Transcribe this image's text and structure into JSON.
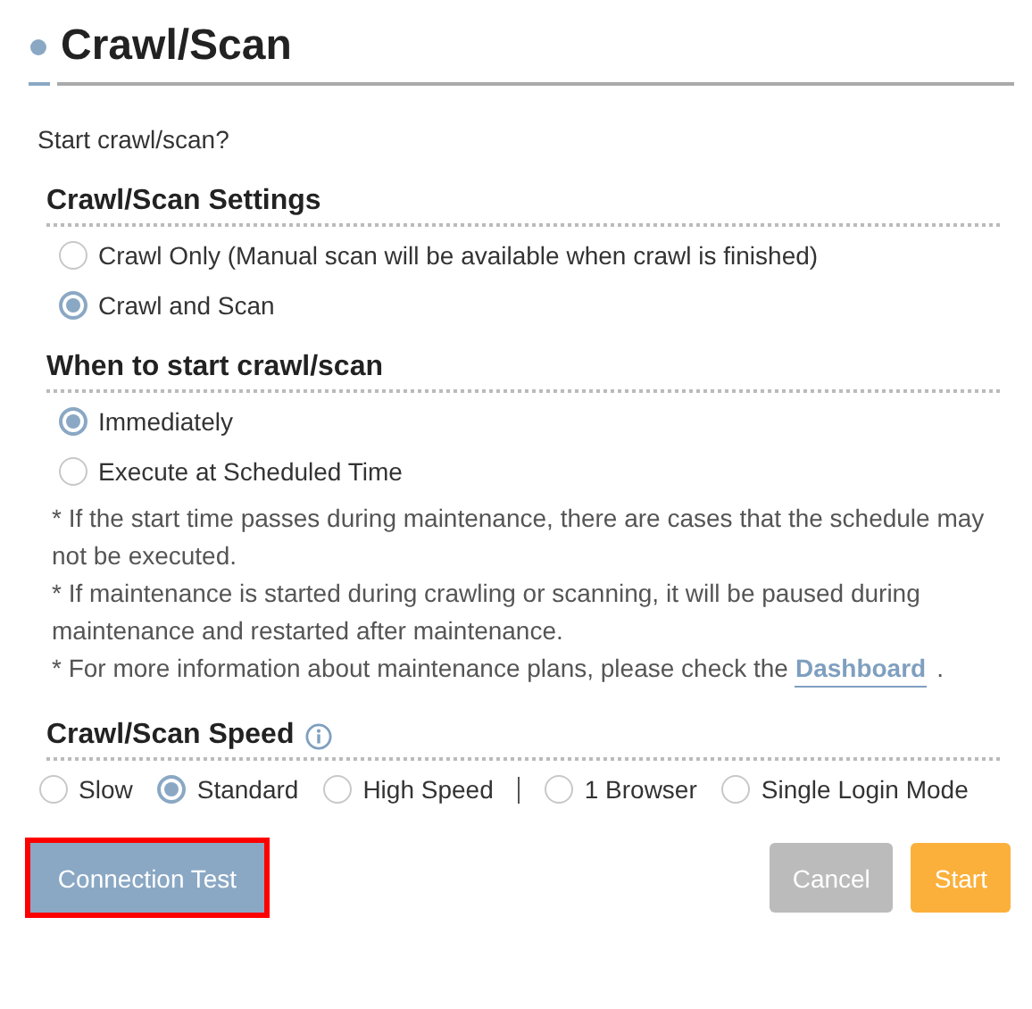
{
  "title": "Crawl/Scan",
  "prompt": "Start crawl/scan?",
  "settings": {
    "heading": "Crawl/Scan Settings",
    "options": [
      {
        "label": "Crawl Only (Manual scan will be available when crawl is finished)",
        "selected": false
      },
      {
        "label": "Crawl and Scan",
        "selected": true
      }
    ]
  },
  "when": {
    "heading": "When to start crawl/scan",
    "options": [
      {
        "label": "Immediately",
        "selected": true
      },
      {
        "label": "Execute at Scheduled Time",
        "selected": false
      }
    ],
    "notes": [
      {
        "text": "* If the start time passes during maintenance, there are cases that the schedule may not be executed."
      },
      {
        "text": "* If maintenance is started during crawling or scanning, it will be paused during maintenance and restarted after maintenance."
      },
      {
        "text": "* For more information about maintenance plans, please check the",
        "link": "Dashboard",
        "after": "."
      }
    ]
  },
  "speed": {
    "heading": "Crawl/Scan Speed",
    "options": [
      {
        "label": "Slow",
        "selected": false
      },
      {
        "label": "Standard",
        "selected": true
      },
      {
        "label": "High Speed",
        "selected": false
      }
    ],
    "modes": [
      {
        "label": "1 Browser",
        "selected": false
      },
      {
        "label": "Single Login Mode",
        "selected": false
      }
    ]
  },
  "buttons": [
    {
      "label": "Connection Test",
      "kind": "test",
      "highlighted": true
    },
    {
      "label": "Cancel",
      "kind": "cancel",
      "highlighted": false
    },
    {
      "label": "Start",
      "kind": "start",
      "highlighted": false
    }
  ]
}
